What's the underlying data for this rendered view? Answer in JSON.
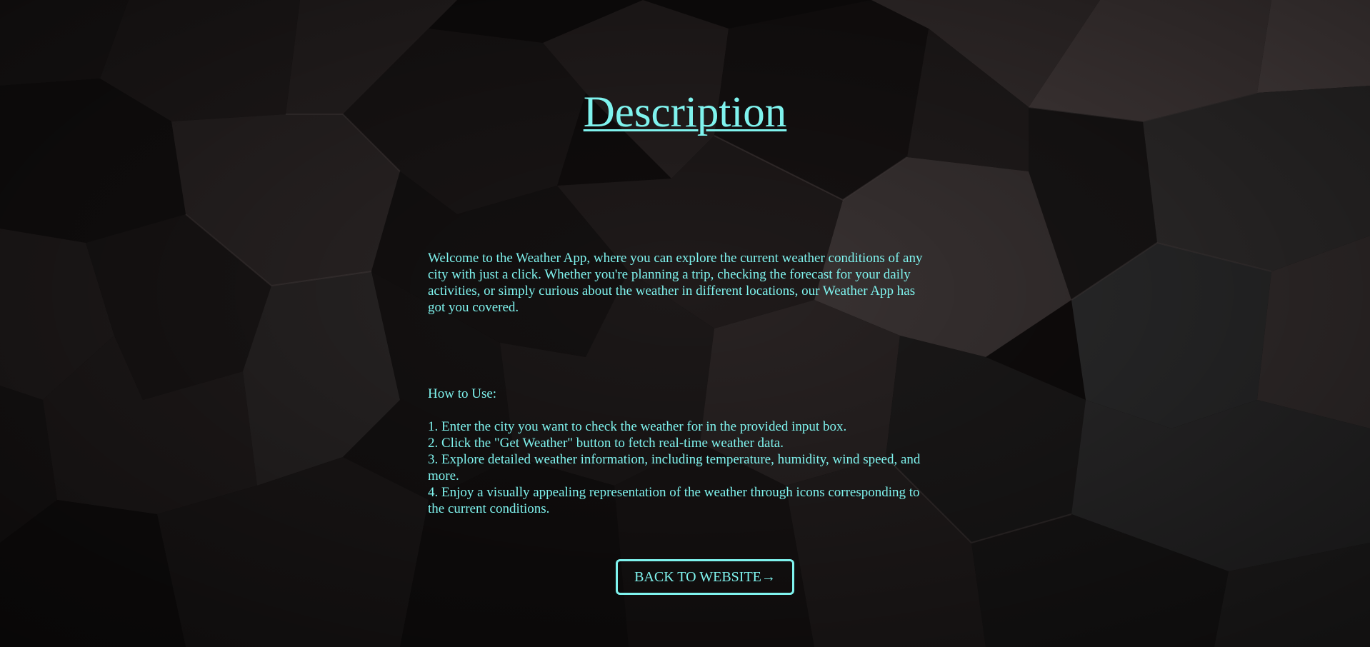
{
  "page": {
    "title": "Description",
    "accent_color": "#7ff3ee",
    "background": "dark-geometric-hexagon-pattern"
  },
  "intro": "Welcome to the Weather App, where you can explore the current weather conditions of any city with just a click. Whether you're planning a trip, checking the forecast for your daily activities, or simply curious about the weather in different locations, our Weather App has got you covered.",
  "how_to": {
    "heading": "How to Use:",
    "steps": [
      "1. Enter the city you want to check the weather for in the provided input box.",
      "2. Click the \"Get Weather\" button to fetch real-time weather data.",
      "3. Explore detailed weather information, including temperature, humidity, wind speed, and more.",
      "4. Enjoy a visually appealing representation of the weather through icons corresponding to the current conditions."
    ]
  },
  "back_button": {
    "label": "BACK TO WEBSITE→"
  }
}
